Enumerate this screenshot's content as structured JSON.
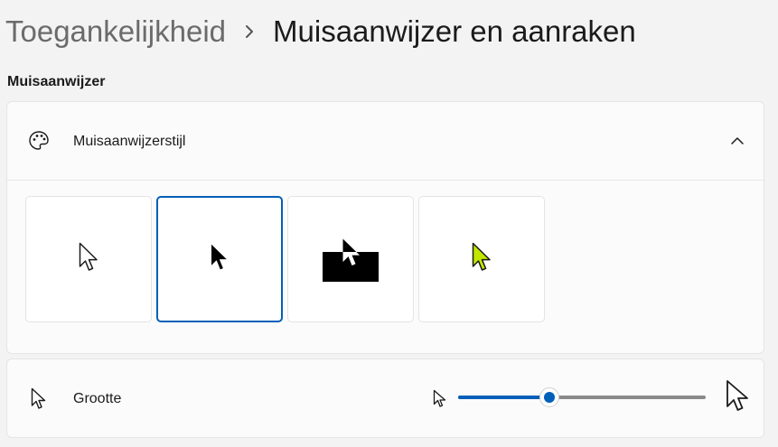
{
  "breadcrumb": {
    "parent": "Toegankelijkheid",
    "separator": "chevron-right",
    "current": "Muisaanwijzer en aanraken"
  },
  "section": {
    "title": "Muisaanwijzer"
  },
  "pointer_style": {
    "label": "Muisaanwijzerstijl",
    "icon": "palette-icon",
    "expanded": true,
    "options": [
      {
        "name": "white",
        "selected": false
      },
      {
        "name": "black",
        "selected": true
      },
      {
        "name": "inverted",
        "selected": false
      },
      {
        "name": "custom",
        "selected": false,
        "color": "#c3e600"
      }
    ]
  },
  "size": {
    "label": "Grootte",
    "icon": "cursor-icon",
    "slider_value_fraction": 0.37
  },
  "colors": {
    "accent": "#005fb8",
    "background": "#f3f3f3",
    "card": "#fbfbfb"
  }
}
